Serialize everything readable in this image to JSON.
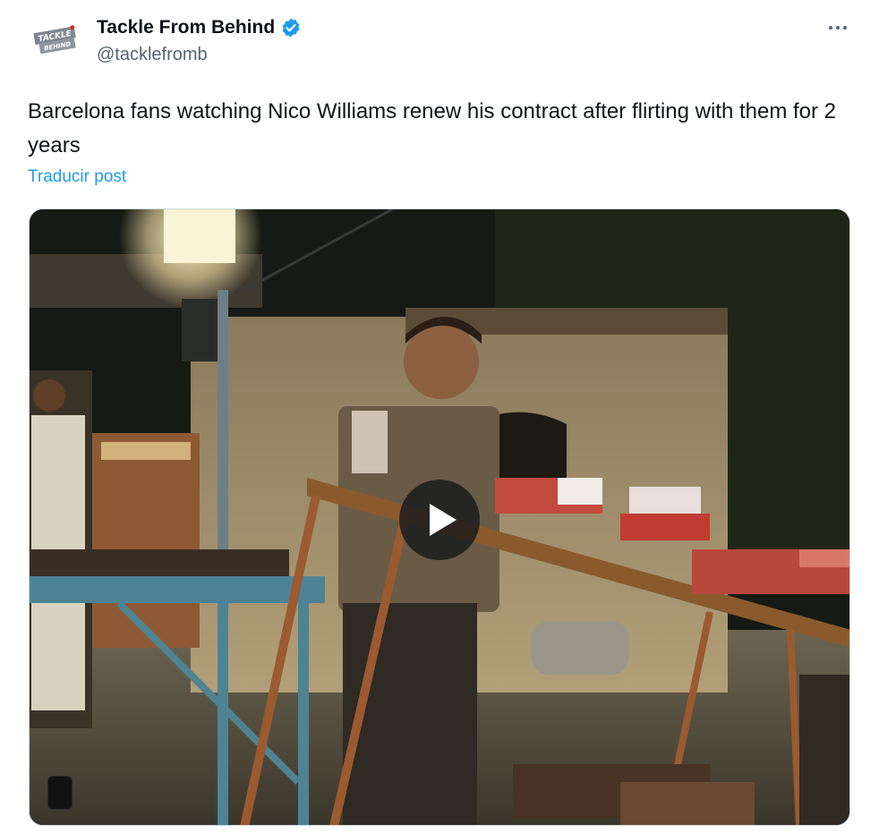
{
  "author": {
    "display_name": "Tackle From Behind",
    "handle": "@tacklefromb",
    "avatar_logo_text": "TACKLE FROM BEHIND",
    "verified_icon": "verified-badge-icon"
  },
  "post": {
    "text": "Barcelona fans watching Nico Williams renew his contract after flirting with them for 2 years",
    "translate_label": "Traducir post"
  },
  "media": {
    "type": "video",
    "play_icon": "play-icon"
  },
  "actions": {
    "more_icon": "more-options-icon"
  },
  "colors": {
    "accent": "#1d9bf0",
    "secondary_text": "#536471",
    "primary_text": "#0f1419"
  }
}
